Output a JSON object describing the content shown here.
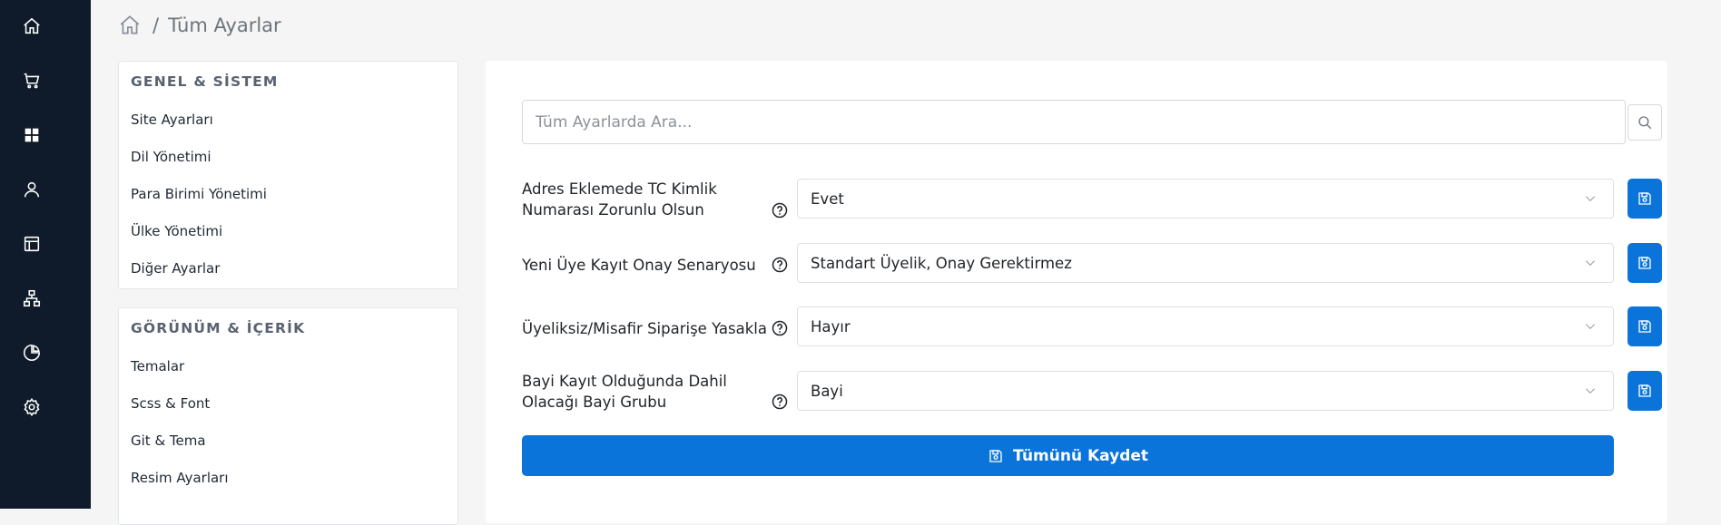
{
  "breadcrumb": {
    "separator": "/",
    "current": "Tüm Ayarlar"
  },
  "rail": {
    "icons": [
      "home-icon",
      "cart-icon",
      "grid-icon",
      "user-icon",
      "layout-icon",
      "sitemap-icon",
      "pie-chart-icon",
      "gear-icon"
    ]
  },
  "nav": {
    "groups": [
      {
        "title": "GENEL & SİSTEM",
        "items": [
          "Site Ayarları",
          "Dil Yönetimi",
          "Para Birimi Yönetimi",
          "Ülke Yönetimi",
          "Diğer Ayarlar"
        ]
      },
      {
        "title": "GÖRÜNÜM & İÇERİK",
        "items": [
          "Temalar",
          "Scss & Font",
          "Git & Tema",
          "Resim Ayarları"
        ]
      }
    ]
  },
  "search": {
    "placeholder": "Tüm Ayarlarda Ara..."
  },
  "settings": [
    {
      "label": "Adres Eklemede TC Kimlik Numarası Zorunlu Olsun",
      "value": "Evet"
    },
    {
      "label": "Yeni Üye Kayıt Onay Senaryosu",
      "value": "Standart Üyelik, Onay Gerektirmez"
    },
    {
      "label": "Üyeliksiz/Misafir Siparişe Yasakla",
      "value": "Hayır"
    },
    {
      "label": "Bayi Kayıt Olduğunda Dahil Olacağı Bayi Grubu",
      "value": "Bayi"
    }
  ],
  "save_all_label": "Tümünü Kaydet",
  "colors": {
    "accent": "#0a74da",
    "rail": "#0f1b2b"
  }
}
